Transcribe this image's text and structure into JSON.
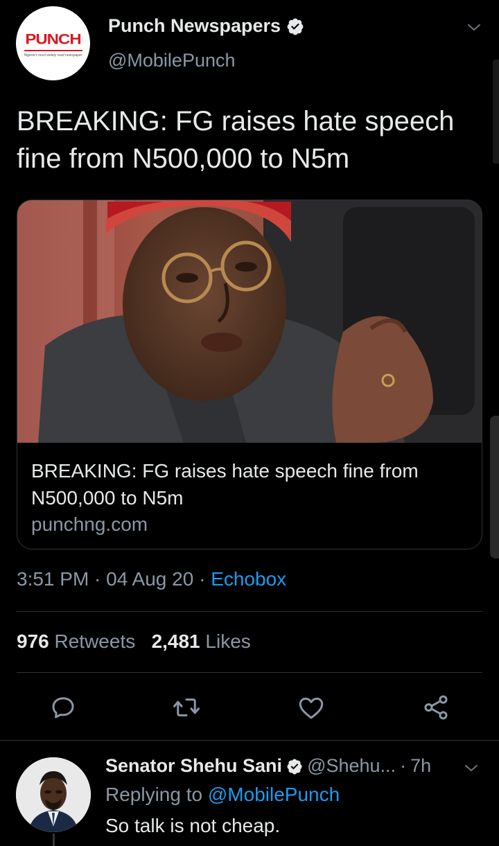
{
  "tweet": {
    "author_name": "Punch Newspapers",
    "author_handle": "@MobilePunch",
    "logo_text": "PUNCH",
    "logo_tagline": "Nigeria's most widely read newspaper",
    "text": "BREAKING: FG raises hate speech fine from N500,000 to N5m",
    "card": {
      "title": "BREAKING: FG raises hate speech fine from N500,000 to N5m",
      "domain": "punchng.com"
    },
    "meta": {
      "time": "3:51 PM",
      "date": "04 Aug 20",
      "source": "Echobox"
    },
    "stats": {
      "retweets_count": "976",
      "retweets_label": "Retweets",
      "likes_count": "2,481",
      "likes_label": "Likes"
    }
  },
  "reply": {
    "author_name": "Senator Shehu Sani",
    "author_handle": "@Shehu...",
    "age": "7h",
    "replying_prefix": "Replying to",
    "replying_mention": "@MobilePunch",
    "text": "So talk is not cheap."
  },
  "colors": {
    "background": "#000000",
    "text": "#e7e9ea",
    "secondary": "#8b98a5",
    "accent": "#1d9bf0",
    "border": "#2f3336",
    "brand_red": "#d71921"
  },
  "icons": [
    "verified-badge-icon",
    "chevron-down-icon",
    "reply-icon",
    "retweet-icon",
    "like-icon",
    "share-icon"
  ]
}
